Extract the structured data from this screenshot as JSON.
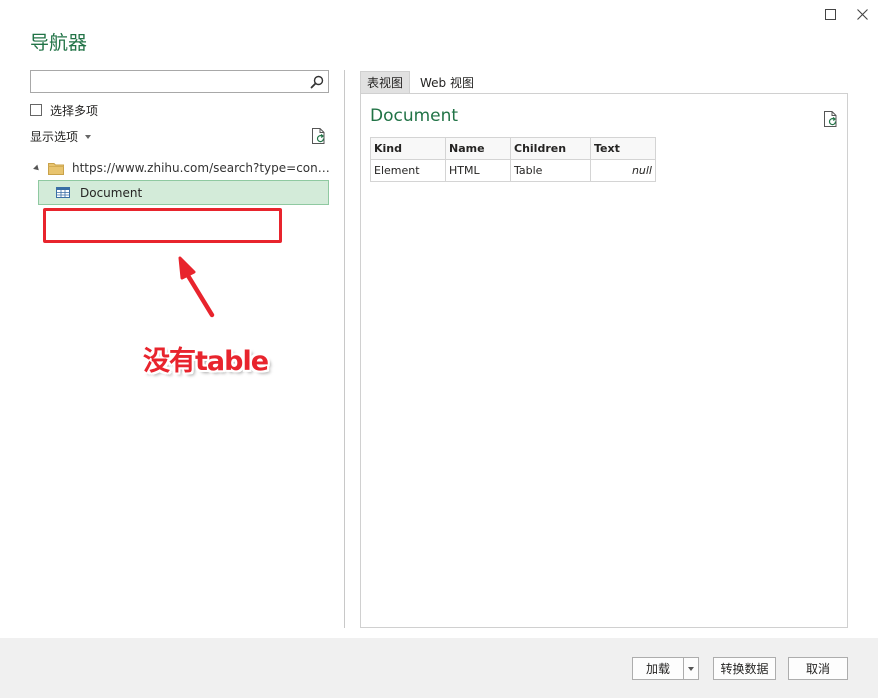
{
  "window": {
    "title": "导航器",
    "maximize_icon": "maximize-icon",
    "close_icon": "close-icon"
  },
  "left": {
    "search": {
      "value": "",
      "placeholder": "",
      "icon": "search-icon"
    },
    "select_multiple_label": "选择多项",
    "select_multiple_checked": false,
    "display_options_label": "显示选项",
    "refresh_icon": "refresh-icon",
    "tree": {
      "root_label": "https://www.zhihu.com/search?type=content&q=...",
      "root_icon": "folder-icon",
      "items": [
        {
          "label": "Document",
          "icon": "table-icon",
          "selected": true
        }
      ]
    }
  },
  "annotation": {
    "text": "没有table",
    "color": "#e8242d"
  },
  "right": {
    "tabs": [
      {
        "label": "表视图",
        "active": true
      },
      {
        "label": "Web 视图",
        "active": false
      }
    ],
    "preview_title": "Document",
    "table": {
      "columns": [
        "Kind",
        "Name",
        "Children",
        "Text"
      ],
      "rows": [
        [
          "Element",
          "HTML",
          "Table",
          "null"
        ]
      ]
    }
  },
  "footer": {
    "load_label": "加载",
    "transform_label": "转换数据",
    "cancel_label": "取消"
  },
  "colors": {
    "accent": "#217346",
    "selection_bg": "#d3ebd9",
    "footer_bg": "#f0f0f0"
  }
}
